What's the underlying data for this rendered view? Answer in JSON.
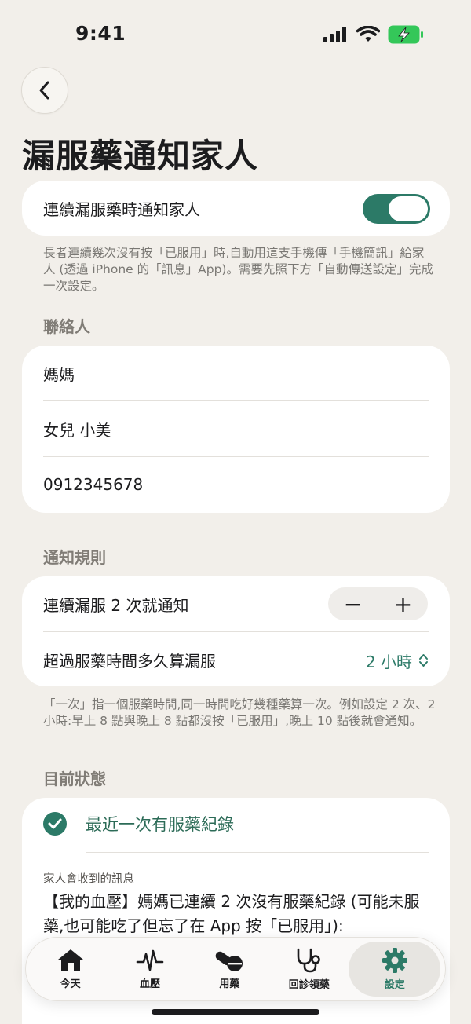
{
  "status_bar": {
    "time": "9:41"
  },
  "header": {
    "title": "漏服藥通知家人"
  },
  "toggle_section": {
    "label": "連續漏服藥時通知家人",
    "enabled": true,
    "footnote": "長者連續幾次沒有按「已服用」時,自動用這支手機傳「手機簡訊」給家人 (透過 iPhone 的「訊息」App)。需要先照下方「自動傳送設定」完成一次設定。"
  },
  "contacts": {
    "section_label": "聯絡人",
    "rows": [
      "媽媽",
      "女兒 小美",
      "0912345678"
    ]
  },
  "rules": {
    "section_label": "通知規則",
    "consecutive_label": "連續漏服 2 次就通知",
    "minus": "−",
    "plus": "+",
    "overdue_label": "超過服藥時間多久算漏服",
    "overdue_value": "2 小時",
    "footnote": "「一次」指一個服藥時間,同一時間吃好幾種藥算一次。例如設定 2 次、2 小時:早上 8 點與晚上 8 點都沒按「已服用」,晚上 10 點後就會通知。"
  },
  "current_status": {
    "section_label": "目前狀態",
    "status_text": "最近一次有服藥紀錄",
    "message_caption": "家人會收到的訊息",
    "message_body": "【我的血壓】媽媽已連續 2 次沒有服藥紀錄 (可能未服藥,也可能吃了但忘了在 App 按「已服用」):"
  },
  "tab_bar": {
    "tabs": [
      {
        "label": "今天",
        "icon": "house-icon"
      },
      {
        "label": "血壓",
        "icon": "heartbeat-icon"
      },
      {
        "label": "用藥",
        "icon": "pills-icon"
      },
      {
        "label": "回診領藥",
        "icon": "stethoscope-icon"
      },
      {
        "label": "設定",
        "icon": "gear-icon"
      }
    ],
    "active_index": 4
  },
  "colors": {
    "accent": "#2c7a67",
    "background": "#f2efea",
    "card": "#ffffff"
  }
}
